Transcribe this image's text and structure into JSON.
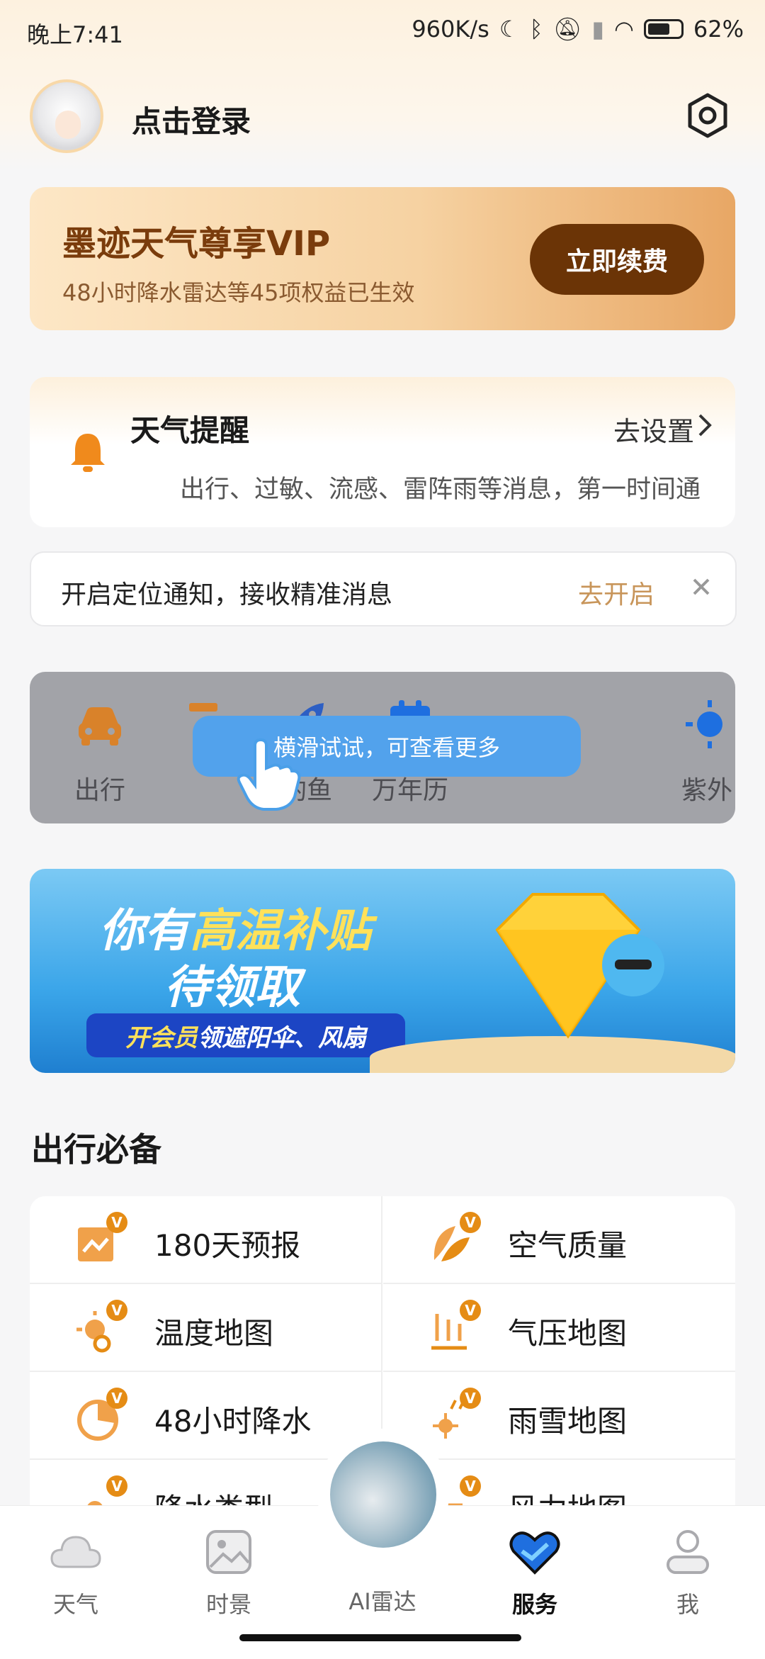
{
  "status_bar": {
    "time": "晚上7:41",
    "net_speed": "960K/s",
    "battery": "62%"
  },
  "header": {
    "login_label": "点击登录"
  },
  "vip_card": {
    "title": "墨迹天气尊享VIP",
    "subtitle": "48小时降水雷达等45项权益已生效",
    "button": "立即续费"
  },
  "reminder": {
    "title": "天气提醒",
    "action": "去设置",
    "description": "出行、过敏、流感、雷阵雨等消息，第一时间通"
  },
  "location_notice": {
    "text": "开启定位通知，接收精准消息",
    "action": "去开启"
  },
  "tools": {
    "hint": "横滑试试，可查看更多",
    "items": [
      {
        "label": "出行",
        "icon": "car-icon"
      },
      {
        "label": "",
        "icon": "tool-icon"
      },
      {
        "label": "钓鱼",
        "icon": "fish-icon"
      },
      {
        "label": "万年历",
        "icon": "calendar-icon"
      },
      {
        "label": "紫外",
        "icon": "sun-icon"
      }
    ]
  },
  "banner": {
    "line1_prefix": "你有",
    "line1_highlight": "高温补贴",
    "line2": "待领取",
    "pill_highlight": "开会员",
    "pill_rest": "领遮阳伞、风扇"
  },
  "section": {
    "title": "出行必备",
    "items": [
      {
        "label": "180天预报",
        "icon": "forecast-icon"
      },
      {
        "label": "空气质量",
        "icon": "leaf-icon"
      },
      {
        "label": "温度地图",
        "icon": "temperature-icon"
      },
      {
        "label": "气压地图",
        "icon": "pressure-icon"
      },
      {
        "label": "48小时降水",
        "icon": "rain-radar-icon"
      },
      {
        "label": "雨雪地图",
        "icon": "snow-icon"
      },
      {
        "label": "降水类型",
        "icon": "precip-type-icon"
      },
      {
        "label": "风力地图",
        "icon": "wind-icon"
      }
    ]
  },
  "nav": {
    "tabs": [
      {
        "label": "天气"
      },
      {
        "label": "时景"
      },
      {
        "label": "AI雷达"
      },
      {
        "label": "服务"
      },
      {
        "label": "我"
      }
    ],
    "active": "服务"
  },
  "colors": {
    "accent": "#e58c15",
    "vip_button": "#6b3406",
    "link": "#c8955a"
  }
}
